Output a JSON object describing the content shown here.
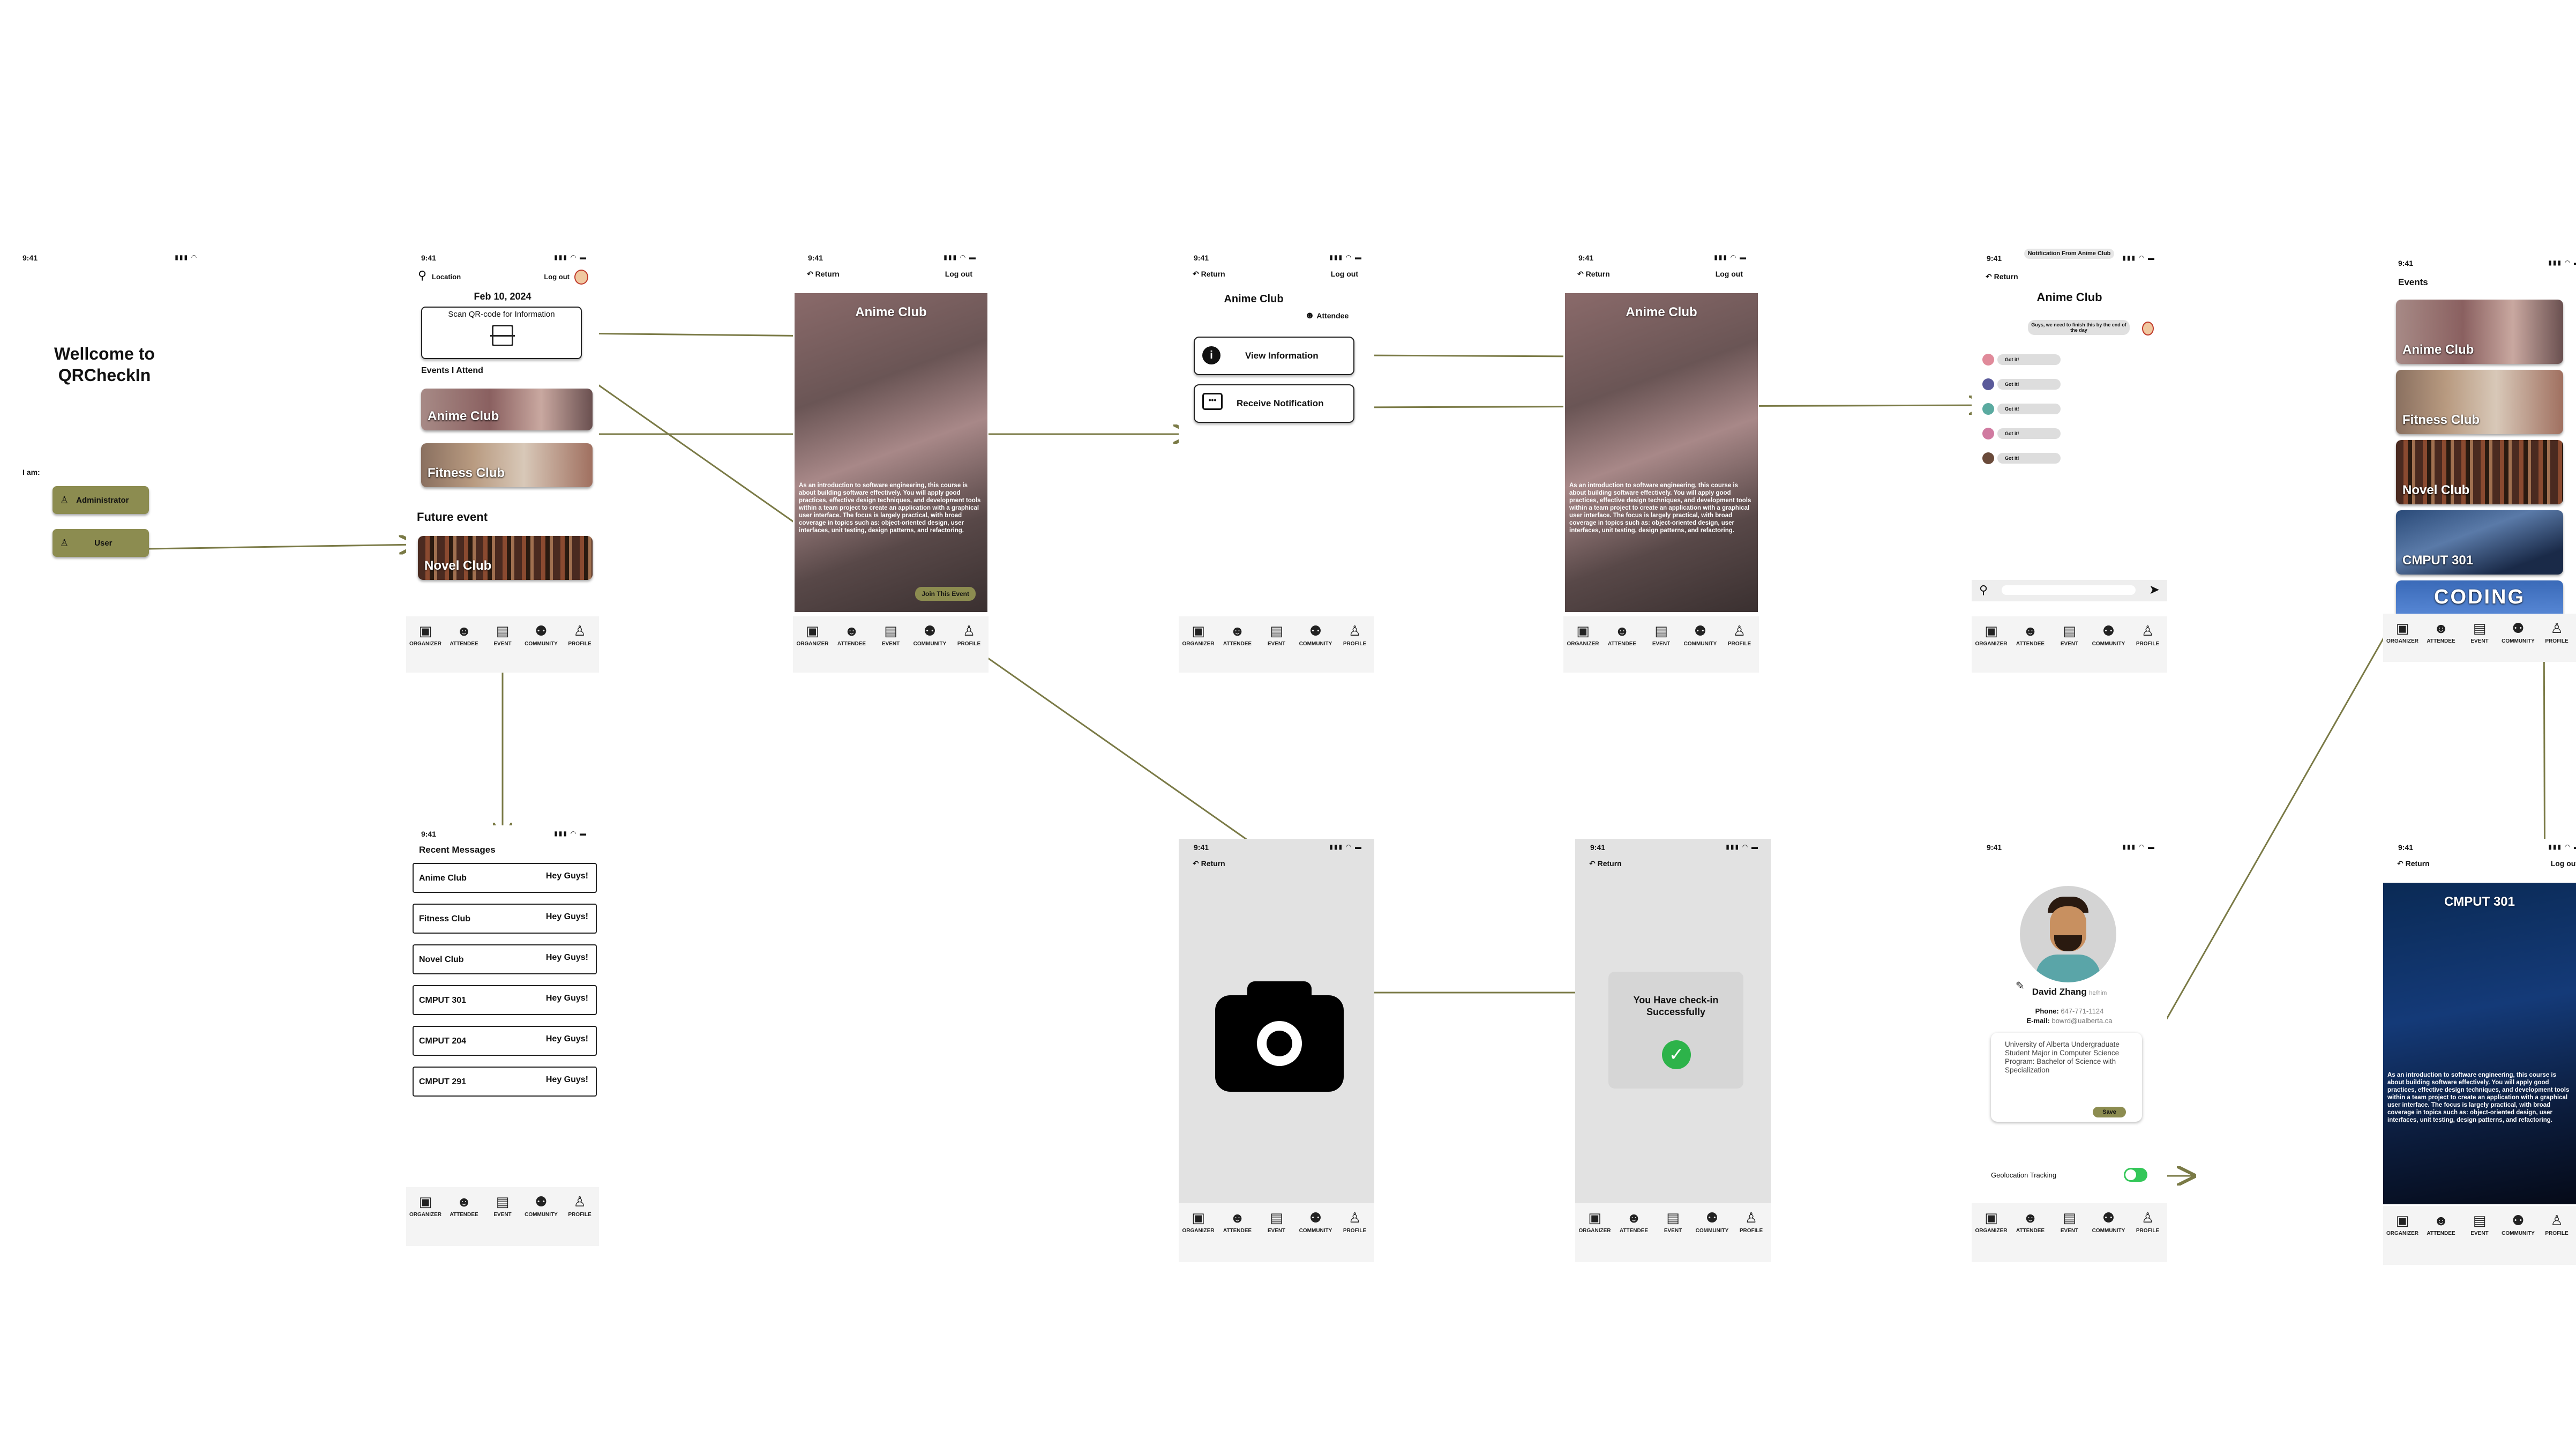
{
  "status": {
    "time": "9:41",
    "icons": "▮▮▮ ◠ ▬"
  },
  "tabbar": [
    {
      "label": "ORGANIZER",
      "icon": "organizer-icon",
      "glyph": "▣"
    },
    {
      "label": "ATTENDEE",
      "icon": "attendee-icon",
      "glyph": "☻"
    },
    {
      "label": "EVENT",
      "icon": "event-icon",
      "glyph": "▤"
    },
    {
      "label": "COMMUNITY",
      "icon": "community-icon",
      "glyph": "⚉"
    },
    {
      "label": "PROFILE",
      "icon": "profile-icon",
      "glyph": "♙"
    }
  ],
  "welcome": {
    "title": "Wellcome to QRCheckIn",
    "i_am": "I am:",
    "admin_label": "Administrator",
    "user_label": "User"
  },
  "home": {
    "location": "Location",
    "logout": "Log out",
    "date": "Feb 10, 2024",
    "scan_label": "Scan QR-code for Information",
    "events_attend": "Events I Attend",
    "event1": "Anime Club",
    "event2": "Fitness Club",
    "future": "Future event",
    "event3": "Novel Club"
  },
  "messages": {
    "title": "Recent Messages",
    "rows": [
      {
        "club": "Anime Club",
        "msg": "Hey Guys!"
      },
      {
        "club": "Fitness Club",
        "msg": "Hey Guys!"
      },
      {
        "club": "Novel Club",
        "msg": "Hey Guys!"
      },
      {
        "club": "CMPUT 301",
        "msg": "Hey Guys!"
      },
      {
        "club": "CMPUT 204",
        "msg": "Hey Guys!"
      },
      {
        "club": "CMPUT 291",
        "msg": "Hey Guys!"
      }
    ]
  },
  "event_detail": {
    "return": "Return",
    "logout": "Log out",
    "title": "Anime Club",
    "desc": "As an introduction to software engineering, this course is about building software effectively. You will apply good practices, effective design techniques, and development tools within a team project to create an application with a graphical user interface. The focus is largely practical, with broad coverage in topics such as: object-oriented design, user interfaces, unit testing, design patterns, and refactoring.",
    "join": "Join This Event"
  },
  "attendee_menu": {
    "return": "Return",
    "logout": "Log out",
    "title": "Anime Club",
    "role": "Attendee",
    "view_info": "View Information",
    "receive": "Receive Notification"
  },
  "notification": {
    "header": "Notification From Anime Club",
    "return": "Return",
    "title": "Anime Club",
    "bubble": "Guys, we need to finish this by the end of the day",
    "replies": [
      "Got it!",
      "Got it!",
      "Got it!",
      "Got it!",
      "Got it!"
    ]
  },
  "events_list": {
    "title": "Events",
    "items": [
      "Anime Club",
      "Fitness Club",
      "Novel Club",
      "CMPUT 301",
      "CODING"
    ]
  },
  "camera": {
    "return": "Return"
  },
  "checkin": {
    "return": "Return",
    "message": "You Have check-in Successfully"
  },
  "profile": {
    "name": "David Zhang",
    "pronoun": "he/him",
    "phone_label": "Phone:",
    "phone": "647-771-1124",
    "email_label": "E-mail:",
    "email": "bowrd@ualberta.ca",
    "bio": "University of Alberta Undergraduate Student Major in Computer Science Program: Bachelor of Science with Specialization",
    "save": "Save",
    "geo": "Geolocation Tracking"
  },
  "course_detail": {
    "return": "Return",
    "logout": "Log out",
    "title": "CMPUT 301",
    "desc": "As an introduction to software engineering, this course is about building software effectively. You will apply good practices, effective design techniques, and development tools within a team project to create an application with a graphical user interface. The focus is largely practical, with broad coverage in topics such as: object-oriented design, user interfaces, unit testing, design patterns, and refactoring."
  },
  "colors": {
    "accent": "#8c8c50",
    "connector": "#7a7a46",
    "success": "#2db34a",
    "toggle": "#34c759"
  }
}
